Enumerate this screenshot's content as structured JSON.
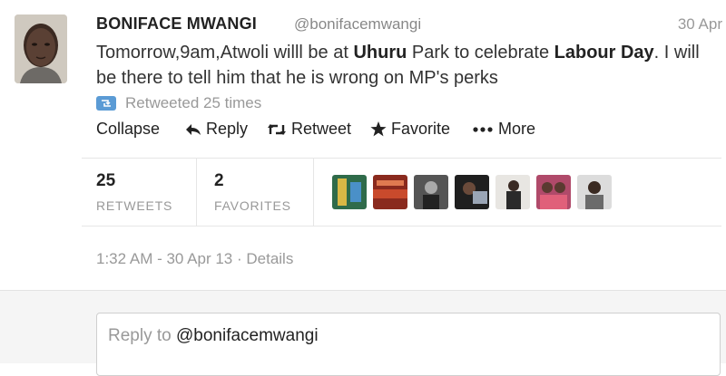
{
  "tweet": {
    "fullname": "BONIFACE MWANGI",
    "username": "@bonifacemwangi",
    "date": "30 Apr",
    "text_parts": [
      "Tomorrow,9am,Atwoli willl be at ",
      "Uhuru",
      " Park to celebrate ",
      "Labour Day",
      ". I will be there to tell him that he is wrong on MP's perks"
    ],
    "retweeted_text": "Retweeted 25 times",
    "avatar_icon": "person-avatar-icon"
  },
  "actions": {
    "collapse": "Collapse",
    "reply": "Reply",
    "retweet": "Retweet",
    "favorite": "Favorite",
    "more": "More"
  },
  "stats": {
    "retweets_count": "25",
    "retweets_label": "RETWEETS",
    "favorites_count": "2",
    "favorites_label": "FAVORITES"
  },
  "meta": {
    "timestamp": "1:32 AM - 30 Apr 13",
    "separator": " · ",
    "details": "Details"
  },
  "reply": {
    "placeholder": "Reply to ",
    "mention": "@bonifacemwangi"
  },
  "colors": {
    "accent": "#5b9bd5",
    "text": "#333333",
    "muted": "#999999"
  }
}
